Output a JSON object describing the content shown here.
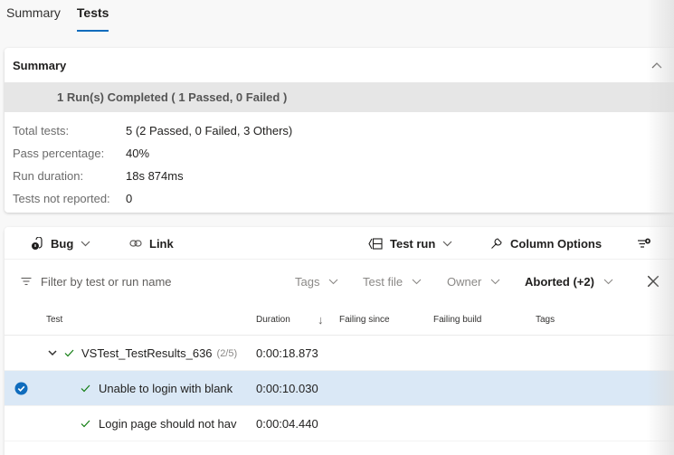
{
  "tabs": [
    {
      "label": "Summary",
      "active": false
    },
    {
      "label": "Tests",
      "active": true
    }
  ],
  "summary": {
    "title": "Summary",
    "run_banner": "1 Run(s) Completed ( 1 Passed, 0 Failed )",
    "stats": [
      {
        "label": "Total tests:",
        "value": "5 (2 Passed, 0 Failed, 3 Others)"
      },
      {
        "label": "Pass percentage:",
        "value": "40%"
      },
      {
        "label": "Run duration:",
        "value": "18s 874ms"
      },
      {
        "label": "Tests not reported:",
        "value": "0"
      }
    ]
  },
  "toolbar": {
    "bug_label": "Bug",
    "link_label": "Link",
    "test_run_label": "Test run",
    "column_options_label": "Column Options"
  },
  "filters": {
    "search_placeholder": "Filter by test or run name",
    "tags_label": "Tags",
    "test_file_label": "Test file",
    "owner_label": "Owner",
    "outcome_label": "Aborted (+2)"
  },
  "grid": {
    "columns": {
      "test": "Test",
      "duration": "Duration",
      "sort_indicator": "↓",
      "failing_since": "Failing since",
      "failing_build": "Failing build",
      "tags": "Tags"
    },
    "rows": [
      {
        "name": "VSTest_TestResults_636",
        "count": "(2/5)",
        "duration": "0:00:18.873",
        "level": 0,
        "outcome": "passed",
        "selected": false
      },
      {
        "name": "Unable to login with blank",
        "count": "",
        "duration": "0:00:10.030",
        "level": 1,
        "outcome": "passed",
        "selected": true
      },
      {
        "name": "Login page should not hav",
        "count": "",
        "duration": "0:00:04.440",
        "level": 1,
        "outcome": "passed",
        "selected": false
      }
    ]
  },
  "colors": {
    "accent": "#0f6cbd",
    "passed": "#107c10",
    "selected_row": "#dae8f6"
  }
}
